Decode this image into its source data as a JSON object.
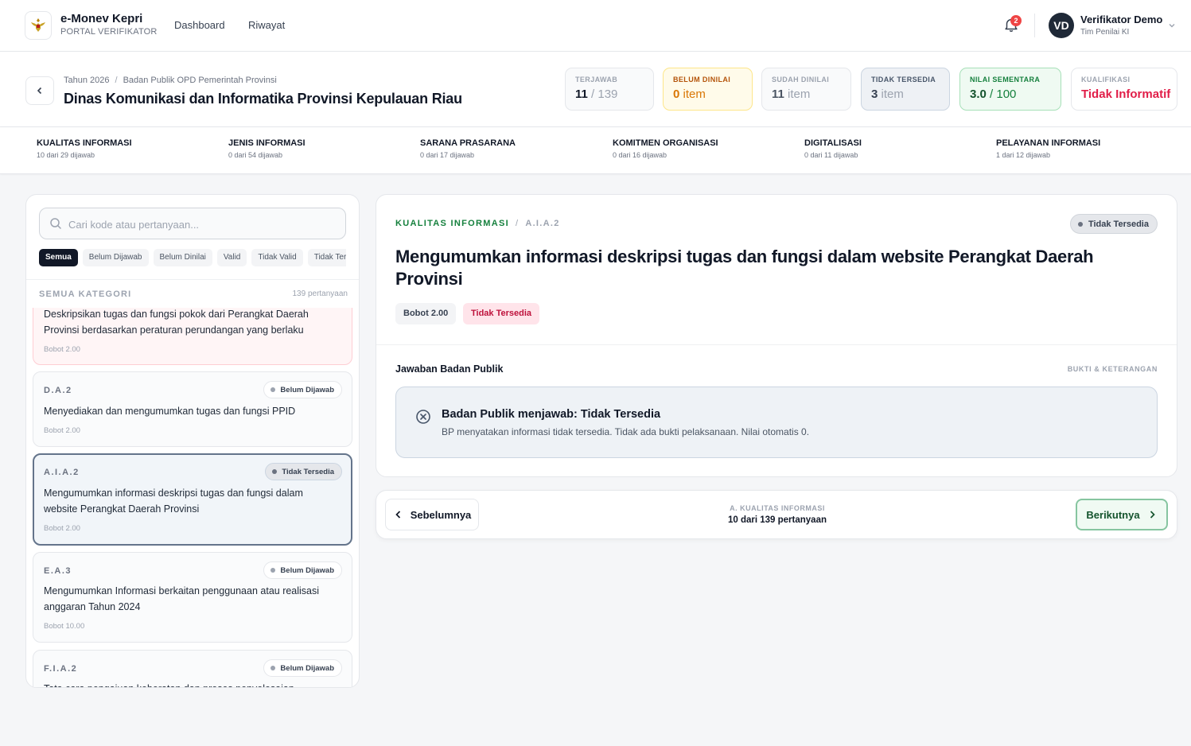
{
  "app": {
    "title": "e-Monev Kepri",
    "subtitle": "PORTAL VERIFIKATOR"
  },
  "nav": {
    "links": [
      "Dashboard",
      "Riwayat"
    ]
  },
  "notifications": {
    "count": "2"
  },
  "user": {
    "initials": "VD",
    "name": "Verifikator Demo",
    "role": "Tim Penilai KI"
  },
  "header": {
    "breadcrumb": [
      "Tahun 2026",
      "Badan Publik OPD Pemerintah Provinsi"
    ],
    "title": "Dinas Komunikasi dan Informatika Provinsi Kepulauan Riau",
    "stats": [
      {
        "label": "TERJAWAB",
        "value": "11",
        "suffix": " / 139"
      },
      {
        "label": "BELUM DINILAI",
        "value": "0",
        "suffix": " item"
      },
      {
        "label": "SUDAH DINILAI",
        "value": "11",
        "suffix": " item"
      },
      {
        "label": "TIDAK TERSEDIA",
        "value": "3",
        "suffix": " item"
      },
      {
        "label": "NILAI SEMENTARA",
        "value": "3.0",
        "suffix": " / 100"
      },
      {
        "label": "KUALIFIKASI",
        "value": "Tidak Informatif",
        "suffix": ""
      }
    ]
  },
  "categories": [
    {
      "name": "KUALITAS INFORMASI",
      "count": "10 dari 29 dijawab"
    },
    {
      "name": "JENIS INFORMASI",
      "count": "0 dari 54 dijawab"
    },
    {
      "name": "SARANA PRASARANA",
      "count": "0 dari 17 dijawab"
    },
    {
      "name": "KOMITMEN ORGANISASI",
      "count": "0 dari 16 dijawab"
    },
    {
      "name": "DIGITALISASI",
      "count": "0 dari 11 dijawab"
    },
    {
      "name": "PELAYANAN INFORMASI",
      "count": "1 dari 12 dijawab"
    }
  ],
  "sidebar": {
    "search_placeholder": "Cari kode atau pertanyaan...",
    "filters": [
      "Semua",
      "Belum Dijawab",
      "Belum Dinilai",
      "Valid",
      "Tidak Valid",
      "Tidak Tersedia"
    ],
    "list_title": "SEMUA KATEGORI",
    "list_count": "139 pertanyaan",
    "items": [
      {
        "code": "",
        "badge": "",
        "question": "Deskripsikan tugas dan fungsi pokok dari Perangkat Daerah Provinsi berdasarkan peraturan perundangan yang berlaku",
        "weight": "Bobot 2.00"
      },
      {
        "code": "D.A.2",
        "badge": "Belum Dijawab",
        "question": "Menyediakan dan mengumumkan tugas dan fungsi PPID",
        "weight": "Bobot 2.00"
      },
      {
        "code": "A.I.A.2",
        "badge": "Tidak Tersedia",
        "question": "Mengumumkan informasi deskripsi tugas dan fungsi dalam website Perangkat Daerah Provinsi",
        "weight": "Bobot 2.00"
      },
      {
        "code": "E.A.3",
        "badge": "Belum Dijawab",
        "question": "Mengumumkan Informasi berkaitan penggunaan atau realisasi anggaran Tahun 2024",
        "weight": "Bobot 10.00"
      },
      {
        "code": "F.I.A.2",
        "badge": "Belum Dijawab",
        "question": "Tata cara pengajuan keberatan dan proses penyelesaian",
        "weight": ""
      }
    ]
  },
  "detail": {
    "category": "KUALITAS INFORMASI",
    "code": "A.I.A.2",
    "status": "Tidak Tersedia",
    "title": "Mengumumkan informasi deskripsi tugas dan fungsi dalam website Perangkat Daerah Provinsi",
    "weight": "Bobot 2.00",
    "status_pill": "Tidak Tersedia",
    "answer_label": "Jawaban Badan Publik",
    "answer_right": "BUKTI & KETERANGAN",
    "answer_title": "Badan Publik menjawab: Tidak Tersedia",
    "answer_desc": "BP menyatakan informasi tidak tersedia. Tidak ada bukti pelaksanaan. Nilai otomatis 0."
  },
  "pager": {
    "prev": "Sebelumnya",
    "next": "Berikutnya",
    "section": "A. KUALITAS INFORMASI",
    "progress": "10 dari 139 pertanyaan"
  },
  "colors": {
    "accent_green": "#15803d",
    "danger": "#e11d48",
    "warning": "#d97706"
  }
}
